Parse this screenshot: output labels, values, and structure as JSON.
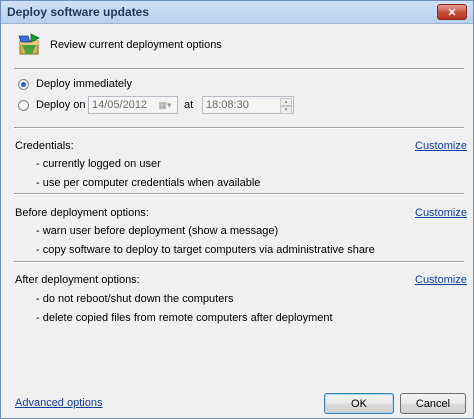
{
  "window": {
    "title": "Deploy software updates",
    "close_glyph": "✕"
  },
  "header": {
    "icon": "deploy-package-icon",
    "text": "Review current deployment options"
  },
  "schedule": {
    "deploy_immediately_label": "Deploy immediately",
    "deploy_on_label": "Deploy on",
    "selected": "deploy_immediately",
    "date_value": "14/05/2012",
    "at_label": "at",
    "time_value": "18:08:30"
  },
  "credentials": {
    "title": "Credentials:",
    "customize_label": "Customize",
    "items": [
      "- currently logged on user",
      "- use per computer credentials when available"
    ]
  },
  "before": {
    "title": "Before deployment options:",
    "customize_label": "Customize",
    "items": [
      "- warn user before deployment (show a message)",
      "- copy software to deploy to target computers via administrative share"
    ]
  },
  "after": {
    "title": "After deployment options:",
    "customize_label": "Customize",
    "items": [
      "- do not reboot/shut down the computers",
      "- delete copied files from remote computers after deployment"
    ]
  },
  "footer": {
    "advanced_label": "Advanced options",
    "ok_label": "OK",
    "cancel_label": "Cancel"
  },
  "colors": {
    "link": "#0e3f9c",
    "radio_selected": "#2a62c9",
    "title_text": "#1e3957"
  }
}
